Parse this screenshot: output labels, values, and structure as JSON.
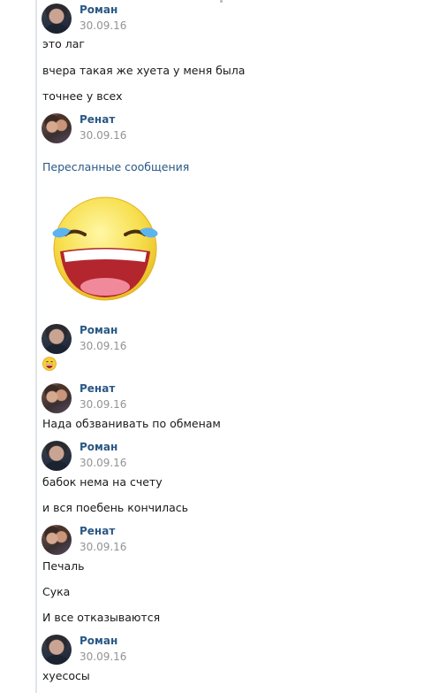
{
  "messages": [
    {
      "author": "Роман",
      "date": "30.09.16",
      "lines": [
        "это лаг",
        "вчера такая же хуета у меня была",
        "точнее у всех"
      ]
    },
    {
      "author": "Ренат",
      "date": "30.09.16",
      "forwarded_label": "Пересланные сообщения",
      "sticker": "laughing-tears-emoji"
    },
    {
      "author": "Роман",
      "date": "30.09.16",
      "emoji": "grinning-face-emoji"
    },
    {
      "author": "Ренат",
      "date": "30.09.16",
      "lines": [
        "Нада обзванивать по обменам"
      ]
    },
    {
      "author": "Роман",
      "date": "30.09.16",
      "lines": [
        "бабок нема на счету",
        "и вся поебень кончилась"
      ]
    },
    {
      "author": "Ренат",
      "date": "30.09.16",
      "lines": [
        "Печаль",
        "Сука",
        "И все отказываются"
      ]
    },
    {
      "author": "Роман",
      "date": "30.09.16",
      "lines": [
        "хуесосы"
      ]
    }
  ],
  "colors": {
    "name": "#2a5885",
    "date": "#939393",
    "text": "#1a1a1a",
    "accent_line": "#dfe4ec"
  }
}
